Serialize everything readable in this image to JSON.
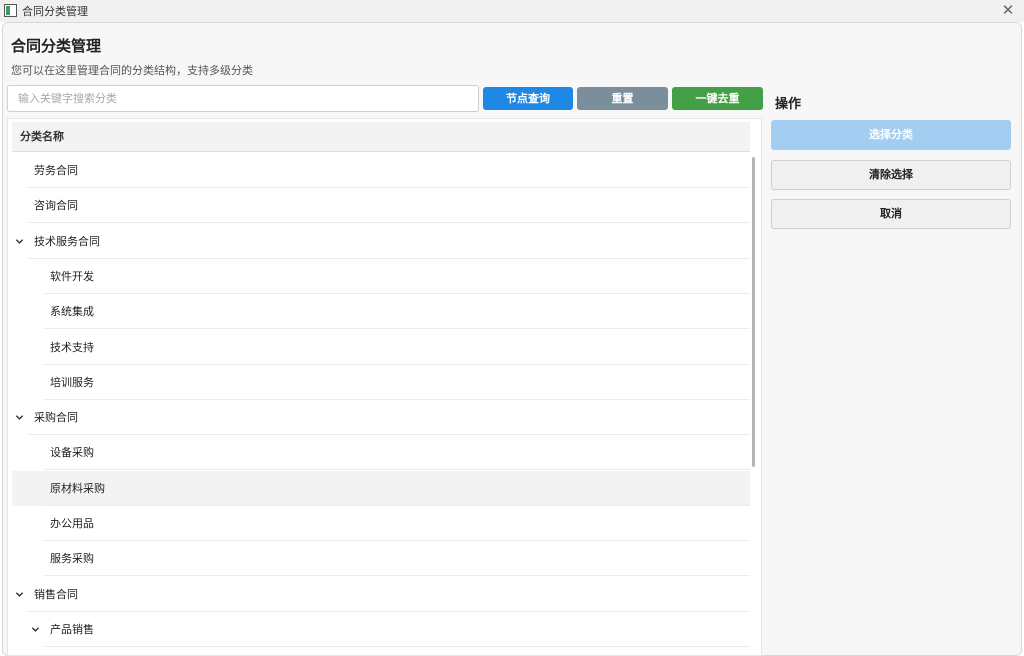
{
  "window": {
    "title": "合同分类管理",
    "close_icon": "close-icon"
  },
  "page": {
    "title": "合同分类管理",
    "subtitle": "您可以在这里管理合同的分类结构，支持多级分类"
  },
  "search": {
    "placeholder": "输入关键字搜索分类",
    "value": ""
  },
  "toolbar": {
    "query_label": "节点查询",
    "reset_label": "重置",
    "dedupe_label": "一键去重",
    "query_color": "#1f88e5",
    "reset_color": "#7a8e9c",
    "dedupe_color": "#43a047"
  },
  "tree": {
    "header": "分类名称",
    "rows": [
      {
        "label": "劳务合同",
        "level": 0,
        "expandable": false
      },
      {
        "label": "咨询合同",
        "level": 0,
        "expandable": false
      },
      {
        "label": "技术服务合同",
        "level": 0,
        "expandable": true
      },
      {
        "label": "软件开发",
        "level": 1,
        "expandable": false
      },
      {
        "label": "系统集成",
        "level": 1,
        "expandable": false
      },
      {
        "label": "技术支持",
        "level": 1,
        "expandable": false
      },
      {
        "label": "培训服务",
        "level": 1,
        "expandable": false
      },
      {
        "label": "采购合同",
        "level": 0,
        "expandable": true
      },
      {
        "label": "设备采购",
        "level": 1,
        "expandable": false
      },
      {
        "label": "原材料采购",
        "level": 1,
        "expandable": false,
        "selected": true
      },
      {
        "label": "办公用品",
        "level": 1,
        "expandable": false
      },
      {
        "label": "服务采购",
        "level": 1,
        "expandable": false
      },
      {
        "label": "销售合同",
        "level": 0,
        "expandable": true
      },
      {
        "label": "产品销售",
        "level": 1,
        "expandable": true
      }
    ]
  },
  "side": {
    "title": "操作",
    "select_label": "选择分类",
    "clear_label": "清除选择",
    "cancel_label": "取消",
    "select_color": "#a3cdf1"
  }
}
